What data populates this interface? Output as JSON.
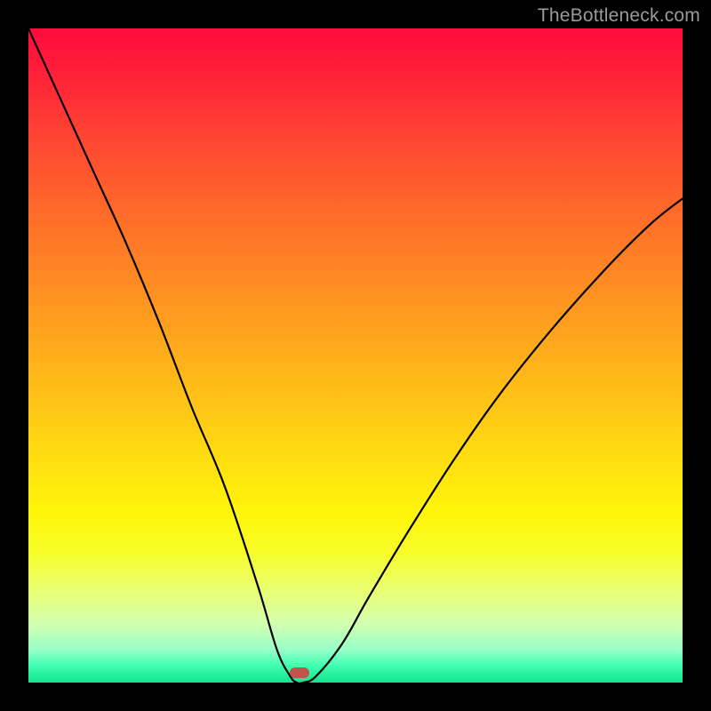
{
  "watermark": "TheBottleneck.com",
  "chart_data": {
    "type": "line",
    "title": "",
    "xlabel": "",
    "ylabel": "",
    "xlim": [
      0,
      100
    ],
    "ylim": [
      0,
      100
    ],
    "grid": false,
    "series": [
      {
        "name": "bottleneck-curve",
        "x": [
          0,
          5,
          10,
          15,
          20,
          25,
          30,
          35,
          38,
          40,
          41,
          42,
          44,
          48,
          52,
          58,
          65,
          72,
          80,
          88,
          95,
          100
        ],
        "y": [
          100,
          89,
          78,
          67,
          55,
          42,
          30,
          15,
          5,
          1,
          0,
          0,
          1,
          6,
          13,
          23,
          34,
          44,
          54,
          63,
          70,
          74
        ]
      }
    ],
    "marker": {
      "x_fraction": 0.415,
      "y_fraction": 0.985,
      "color": "#c1524e"
    },
    "background_gradient": {
      "stops": [
        {
          "pos": 0.0,
          "color": "#ff0a3e"
        },
        {
          "pos": 0.15,
          "color": "#ff3f33"
        },
        {
          "pos": 0.4,
          "color": "#ff8f22"
        },
        {
          "pos": 0.64,
          "color": "#ffd812"
        },
        {
          "pos": 0.8,
          "color": "#f7fd28"
        },
        {
          "pos": 0.95,
          "color": "#98ffca"
        },
        {
          "pos": 1.0,
          "color": "#12e48c"
        }
      ]
    }
  }
}
